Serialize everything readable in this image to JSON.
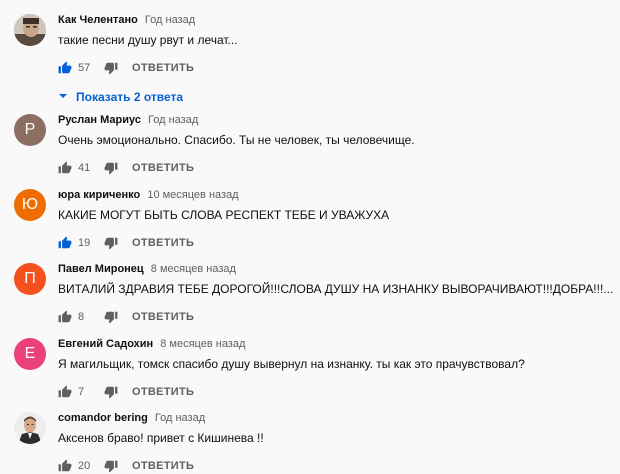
{
  "comments": [
    {
      "author": "Как Челентано",
      "time": "Год назад",
      "text": "такие песни душу рвут и лечат...",
      "likes": "57",
      "reply_label": "ОТВЕТИТЬ",
      "avatar_letter": "",
      "avatar_color": "#8a7a6c",
      "liked": true,
      "show_replies": "Показать 2 ответа"
    },
    {
      "author": "Руслан Мариус",
      "time": "Год назад",
      "text": "Очень эмоционально. Спасибо. Ты не человек, ты человечище.",
      "likes": "41",
      "reply_label": "ОТВЕТИТЬ",
      "avatar_letter": "Р",
      "avatar_color": "#8d6e63",
      "liked": false
    },
    {
      "author": "юра кириченко",
      "time": "10 месяцев назад",
      "text": "КАКИЕ МОГУТ БЫТЬ СЛОВА РЕСПЕКТ ТЕБЕ  И УВАЖУХА",
      "likes": "19",
      "reply_label": "ОТВЕТИТЬ",
      "avatar_letter": "Ю",
      "avatar_color": "#ef6c00",
      "liked": true
    },
    {
      "author": "Павел Миронец",
      "time": "8 месяцев назад",
      "text": "ВИТАЛИЙ ЗДРАВИЯ ТЕБЕ ДОРОГОЙ!!!СЛОВА ДУШУ НА ИЗНАНКУ ВЫВОРАЧИВАЮТ!!!ДОБРА!!!...",
      "likes": "8",
      "reply_label": "ОТВЕТИТЬ",
      "avatar_letter": "П",
      "avatar_color": "#f4511e",
      "liked": false
    },
    {
      "author": "Евгений Садохин",
      "time": "8 месяцев назад",
      "text": "Я магильщик, томск спасибо душу вывернул на изнанку. ты как это прачувствовал?",
      "likes": "7",
      "reply_label": "ОТВЕТИТЬ",
      "avatar_letter": "Е",
      "avatar_color": "#ec407a",
      "liked": false
    },
    {
      "author": "comandor bering",
      "time": "Год назад",
      "text": "Аксенов браво! привет с Кишинева !!",
      "likes": "20",
      "reply_label": "ОТВЕТИТЬ",
      "avatar_letter": "",
      "avatar_color": "#e8e8e8",
      "liked": false
    }
  ],
  "icons": {
    "like": "thumb-up-icon",
    "dislike": "thumb-down-icon",
    "expand": "chevron-down-icon"
  },
  "colors": {
    "liked": "#065fd4",
    "neutral": "#909090",
    "link": "#065fd4"
  }
}
